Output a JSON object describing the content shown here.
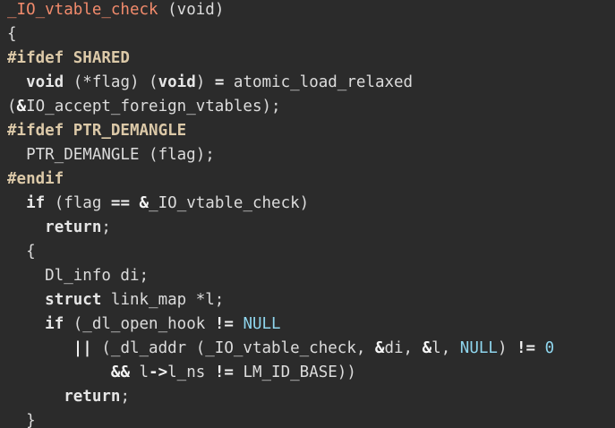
{
  "code_lines": [
    [
      {
        "t": "_IO_vtable_check",
        "c": "fn"
      },
      {
        "t": " (",
        "c": "plain"
      },
      {
        "t": "void",
        "c": "plain"
      },
      {
        "t": ")",
        "c": "plain"
      }
    ],
    [
      {
        "t": "{",
        "c": "plain"
      }
    ],
    [
      {
        "t": "#ifdef SHARED",
        "c": "pp"
      }
    ],
    [
      {
        "t": "  ",
        "c": "plain"
      },
      {
        "t": "void",
        "c": "kw"
      },
      {
        "t": " (*flag) (",
        "c": "plain"
      },
      {
        "t": "void",
        "c": "kw"
      },
      {
        "t": ") ",
        "c": "plain"
      },
      {
        "t": "=",
        "c": "op"
      },
      {
        "t": " atomic_load_relaxed",
        "c": "plain"
      }
    ],
    [
      {
        "t": "(",
        "c": "plain"
      },
      {
        "t": "&",
        "c": "op"
      },
      {
        "t": "IO_accept_foreign_vtables);",
        "c": "plain"
      }
    ],
    [
      {
        "t": "#ifdef PTR_DEMANGLE",
        "c": "pp"
      }
    ],
    [
      {
        "t": "  PTR_DEMANGLE (flag);",
        "c": "plain"
      }
    ],
    [
      {
        "t": "#endif",
        "c": "pp"
      }
    ],
    [
      {
        "t": "  ",
        "c": "plain"
      },
      {
        "t": "if",
        "c": "kw"
      },
      {
        "t": " (flag ",
        "c": "plain"
      },
      {
        "t": "==",
        "c": "op"
      },
      {
        "t": " ",
        "c": "plain"
      },
      {
        "t": "&",
        "c": "op"
      },
      {
        "t": "_IO_vtable_check)",
        "c": "plain"
      }
    ],
    [
      {
        "t": "    ",
        "c": "plain"
      },
      {
        "t": "return",
        "c": "kw"
      },
      {
        "t": ";",
        "c": "plain"
      }
    ],
    [
      {
        "t": "  {",
        "c": "plain"
      }
    ],
    [
      {
        "t": "    Dl_info di;",
        "c": "plain"
      }
    ],
    [
      {
        "t": "    ",
        "c": "plain"
      },
      {
        "t": "struct",
        "c": "kw"
      },
      {
        "t": " link_map *l;",
        "c": "plain"
      }
    ],
    [
      {
        "t": "    ",
        "c": "plain"
      },
      {
        "t": "if",
        "c": "kw"
      },
      {
        "t": " (_dl_open_hook ",
        "c": "plain"
      },
      {
        "t": "!=",
        "c": "op"
      },
      {
        "t": " ",
        "c": "plain"
      },
      {
        "t": "NULL",
        "c": "const"
      }
    ],
    [
      {
        "t": "       ",
        "c": "plain"
      },
      {
        "t": "||",
        "c": "op"
      },
      {
        "t": " (_dl_addr (_IO_vtable_check, ",
        "c": "plain"
      },
      {
        "t": "&",
        "c": "op"
      },
      {
        "t": "di, ",
        "c": "plain"
      },
      {
        "t": "&",
        "c": "op"
      },
      {
        "t": "l, ",
        "c": "plain"
      },
      {
        "t": "NULL",
        "c": "const"
      },
      {
        "t": ") ",
        "c": "plain"
      },
      {
        "t": "!=",
        "c": "op"
      },
      {
        "t": " ",
        "c": "plain"
      },
      {
        "t": "0",
        "c": "const"
      }
    ],
    [
      {
        "t": "           ",
        "c": "plain"
      },
      {
        "t": "&&",
        "c": "op"
      },
      {
        "t": " l",
        "c": "plain"
      },
      {
        "t": "->",
        "c": "op"
      },
      {
        "t": "l_ns ",
        "c": "plain"
      },
      {
        "t": "!=",
        "c": "op"
      },
      {
        "t": " LM_ID_BASE))",
        "c": "plain"
      }
    ],
    [
      {
        "t": "      ",
        "c": "plain"
      },
      {
        "t": "return",
        "c": "kw"
      },
      {
        "t": ";",
        "c": "plain"
      }
    ],
    [
      {
        "t": "  }",
        "c": "plain"
      }
    ]
  ]
}
